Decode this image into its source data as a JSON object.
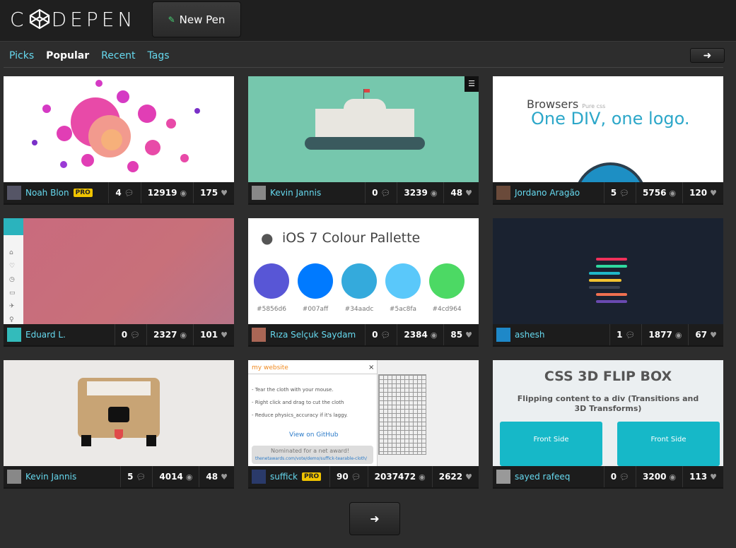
{
  "header": {
    "logo": "CODEPEN",
    "new_pen_label": "New Pen"
  },
  "tabs": [
    {
      "label": "Picks",
      "active": false
    },
    {
      "label": "Popular",
      "active": true
    },
    {
      "label": "Recent",
      "active": false
    },
    {
      "label": "Tags",
      "active": false
    }
  ],
  "pens": [
    {
      "author": "Noah Blon",
      "pro": true,
      "comments": "4",
      "views": "12919",
      "hearts": "175"
    },
    {
      "author": "Kevin Jannis",
      "pro": false,
      "comments": "0",
      "views": "3239",
      "hearts": "48"
    },
    {
      "author": "Jordano Aragão",
      "pro": false,
      "comments": "5",
      "views": "5756",
      "hearts": "120"
    },
    {
      "author": "Eduard L.",
      "pro": false,
      "comments": "0",
      "views": "2327",
      "hearts": "101"
    },
    {
      "author": "Rıza Selçuk Saydam",
      "pro": false,
      "comments": "0",
      "views": "2384",
      "hearts": "85"
    },
    {
      "author": "ashesh",
      "pro": false,
      "comments": "1",
      "views": "1877",
      "hearts": "67"
    },
    {
      "author": "Kevin Jannis",
      "pro": false,
      "comments": "5",
      "views": "4014",
      "hearts": "48"
    },
    {
      "author": "suffick",
      "pro": true,
      "comments": "90",
      "views": "2037472",
      "hearts": "2622"
    },
    {
      "author": "sayed rafeeq",
      "pro": false,
      "comments": "0",
      "views": "3200",
      "hearts": "113"
    }
  ],
  "pro_label": "PRO",
  "thumbs": {
    "browsers": {
      "title": "Browsers",
      "sub": "Pure css",
      "headline": "One DIV, one logo."
    },
    "ios": {
      "title": "iOS 7 Colour Pallette",
      "swatches": [
        {
          "color": "#5856d6",
          "label": "#5856d6"
        },
        {
          "color": "#007aff",
          "label": "#007aff"
        },
        {
          "color": "#34aadc",
          "label": "#34aadc"
        },
        {
          "color": "#5ac8fa",
          "label": "#5ac8fa"
        },
        {
          "color": "#4cd964",
          "label": "#4cd964"
        }
      ]
    },
    "cloth": {
      "site": "my website",
      "close": "×",
      "lines": [
        "- Tear the cloth with your mouse.",
        "- Right click and drag to cut the cloth",
        "- Reduce physics_accuracy if it's laggy."
      ],
      "link": "View on GitHub",
      "award": "Nominated for a net award!",
      "award_url": "thenetawards.com/vote/demo/suffick-tearable-cloth/"
    },
    "flip": {
      "title": "CSS 3D FLIP BOX",
      "sub": "Flipping content to a div (Transitions and 3D Transforms)",
      "front1": "Front Side",
      "front2": "Front Side"
    }
  },
  "icons": {
    "comment": "comment-icon",
    "view": "eye-icon",
    "heart": "heart-icon",
    "next": "arrow-right-icon"
  },
  "colors": {
    "accent": "#66d9ef",
    "pro": "#f0c400",
    "background": "#2d2d2d"
  }
}
